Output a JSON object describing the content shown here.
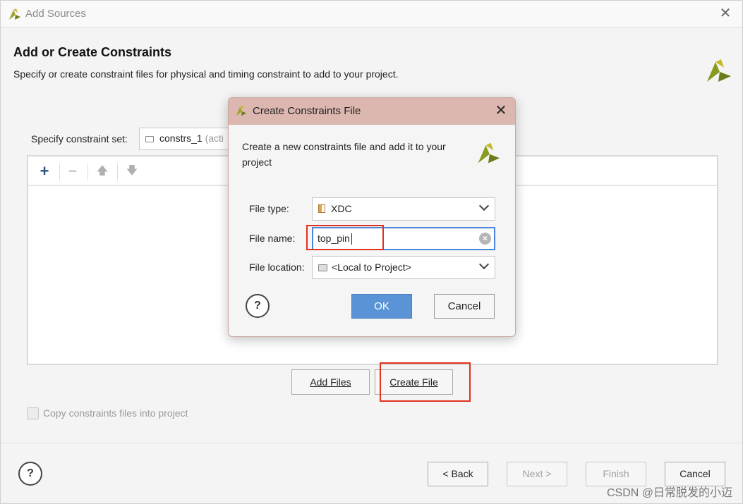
{
  "window": {
    "title": "Add Sources",
    "close_glyph": "✕"
  },
  "header": {
    "title": "Add or Create Constraints",
    "description": "Specify or create constraint files for physical and timing constraint to add to your project."
  },
  "constraint_set": {
    "label": "Specify constraint set:",
    "value": "constrs_1",
    "value_suffix": "(acti"
  },
  "toolbar": {
    "add_glyph": "+",
    "remove_glyph": "−",
    "up_glyph": "🡅",
    "down_glyph": "🡇"
  },
  "file_actions": {
    "add_files": "Add Files",
    "create_file": "Create File"
  },
  "copy_option": {
    "label": "Copy constraints files into project",
    "checked": false
  },
  "footer": {
    "help_glyph": "?",
    "back": "< Back",
    "next": "Next >",
    "finish": "Finish",
    "cancel": "Cancel"
  },
  "dialog": {
    "title": "Create Constraints File",
    "close_glyph": "✕",
    "description": "Create a new constraints file and add it to your project",
    "file_type_label": "File type:",
    "file_type_value": "XDC",
    "file_name_label": "File name:",
    "file_name_value": "top_pin",
    "file_location_label": "File location:",
    "file_location_value": "<Local to Project>",
    "help_glyph": "?",
    "ok": "OK",
    "cancel": "Cancel",
    "clear_glyph": "×"
  },
  "watermark": "CSDN @日常脱发的小迈",
  "colors": {
    "dialog_title_bg": "#dbb7af",
    "ok_button_bg": "#5b94d6",
    "highlight_red": "#e0301e",
    "logo_green": "#8a9a1e"
  }
}
